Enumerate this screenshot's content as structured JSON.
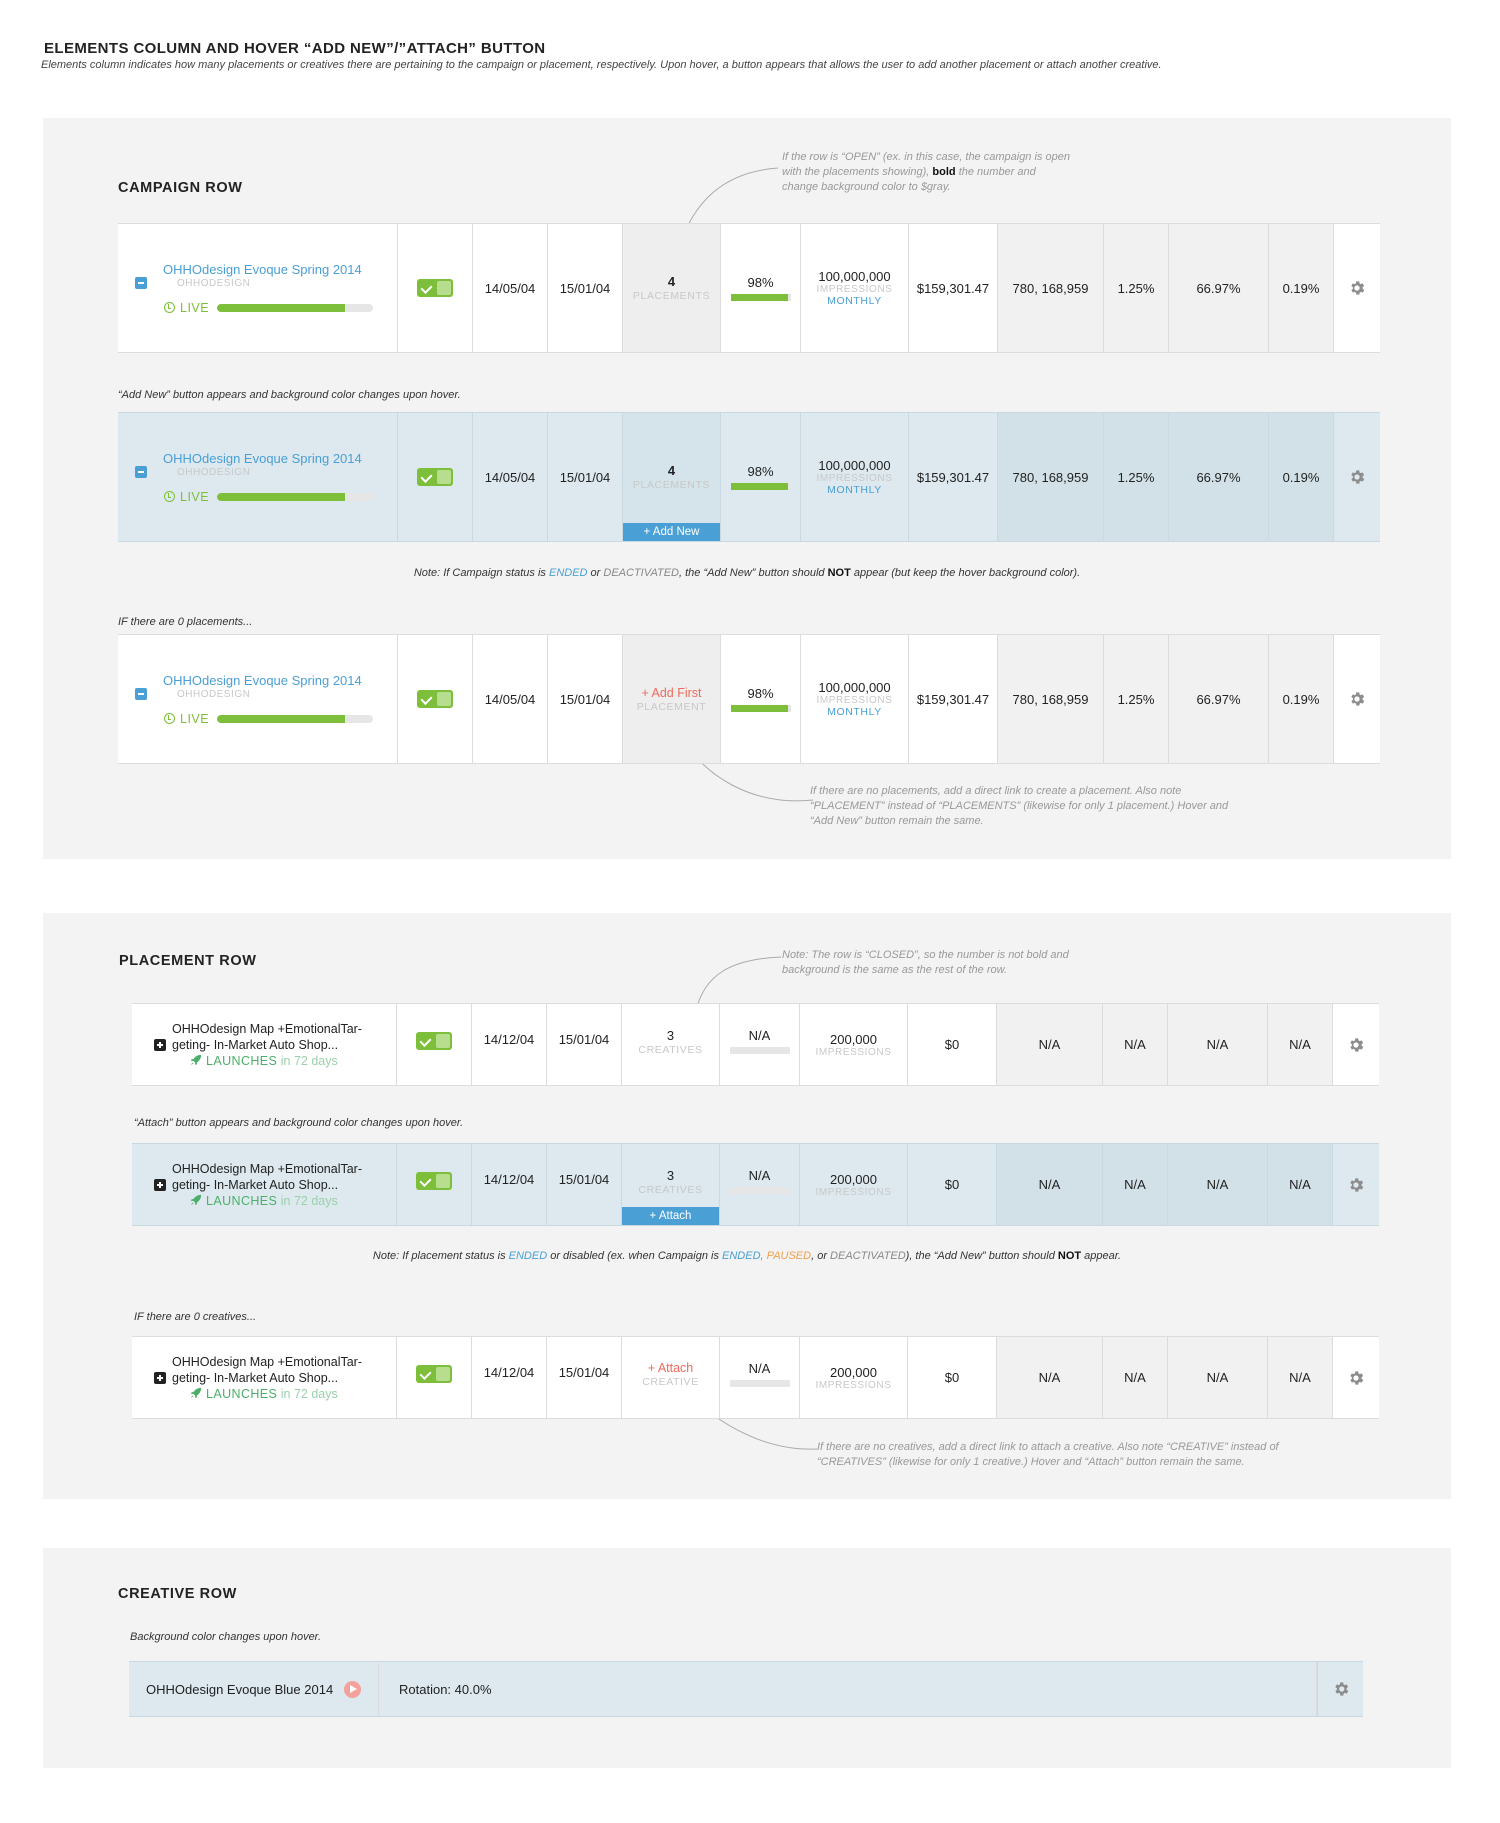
{
  "header": {
    "title": "ELEMENTS COLUMN AND HOVER “ADD NEW”/”ATTACH” BUTTON",
    "subtitle": "Elements column indicates how many placements or creatives there are pertaining to the campaign or placement, respectively. Upon hover, a button appears that allows the user to add another placement or attach another creative."
  },
  "colors": {
    "blue": "#4a9fd5",
    "green": "#7dbf3a",
    "red": "#ef6a5c",
    "hover_bg": "#dde9ef",
    "panel_bg": "#f3f3f3"
  },
  "campaign": {
    "section_title": "CAMPAIGN ROW",
    "open_note": {
      "pre": "If the row is “OPEN” (ex. in this case, the campaign is open",
      "line2_pre": "with the placements showing), ",
      "bold": "bold",
      "line2_post": " the number and",
      "line3": "change background color to $gray."
    },
    "hover_note": "“Add New” button appears and background color changes upon hover.",
    "status_note": {
      "pre": "Note: If Campaign status is ",
      "ended": "ENDED",
      "or": " or ",
      "deactivated": "DEACTIVATED",
      "mid": ", the “Add New” button should ",
      "not": "NOT",
      "post": " appear (but keep the hover background color)."
    },
    "zero_note": "IF there are 0 placements...",
    "zero_explain": {
      "l1": "If there are no placements, add a direct link to create a placement. Also note",
      "l2": "“PLACEMENT” instead of “PLACEMENTS” (likewise for only 1 placement.) Hover and",
      "l3": "“Add New” button remain the same."
    },
    "row": {
      "name": "OHHOdesign Evoque Spring 2014",
      "org": "OHHODESIGN",
      "status": "LIVE",
      "progress": 0.82,
      "start": "14/05/04",
      "end": "15/01/04",
      "elements_num": "4",
      "elements_label": "PLACEMENTS",
      "add_new": "+ Add New",
      "add_first": "+ Add First",
      "add_first_label": "PLACEMENT",
      "pacing": "98%",
      "pacing_fill": 0.96,
      "impressions": "100,000,000",
      "imp_label": "IMPRESSIONS",
      "imp_period": "MONTHLY",
      "budget": "$159,301.47",
      "delivered": "780, 168,959",
      "ctr": "1.25%",
      "viewability": "66.97%",
      "conv": "0.19%",
      "gear_icon": "gear-icon"
    }
  },
  "placement": {
    "section_title": "PLACEMENT ROW",
    "closed_note": {
      "l1": "Note: The row is “CLOSED”, so the number is not bold and",
      "l2": "background is the same as the rest of the row."
    },
    "hover_note": "“Attach” button appears and background color changes upon hover.",
    "status_note": {
      "pre": "Note: If placement status is ",
      "ended": "ENDED",
      "mid1": " or disabled (ex. when Campaign is ",
      "ended2": "ENDED",
      "comma": ", ",
      "paused": "PAUSED",
      "or": ", or ",
      "deactivated": "DEACTIVATED",
      "mid2": "), the “Add New” button should ",
      "not": "NOT",
      "post": " appear."
    },
    "zero_note": "IF there are 0 creatives...",
    "zero_explain": {
      "l1": "If there are no creatives, add a direct link to attach a creative. Also note “CREATIVE” instead of",
      "l2": "“CREATIVES” (likewise for only 1 creative.) Hover and “Attach” button remain the same."
    },
    "row": {
      "name_l1": "OHHOdesign Map +EmotionalTar-",
      "name_l2": "geting- In-Market Auto Shop...",
      "launch": "LAUNCHES",
      "launch_days": " in 72 days",
      "start": "14/12/04",
      "end": "15/01/04",
      "elements_num": "3",
      "elements_label": "CREATIVES",
      "attach": "+ Attach",
      "attach_first_label": "CREATIVE",
      "pacing": "N/A",
      "impressions": "200,000",
      "imp_label": "IMPRESSIONS",
      "budget": "$0",
      "delivered": "N/A",
      "ctr": "N/A",
      "viewability": "N/A",
      "conv": "N/A"
    }
  },
  "creative": {
    "section_title": "CREATIVE ROW",
    "hover_note": "Background color changes upon hover.",
    "row": {
      "name": "OHHOdesign Evoque Blue 2014",
      "rotation": "Rotation: 40.0%"
    }
  }
}
